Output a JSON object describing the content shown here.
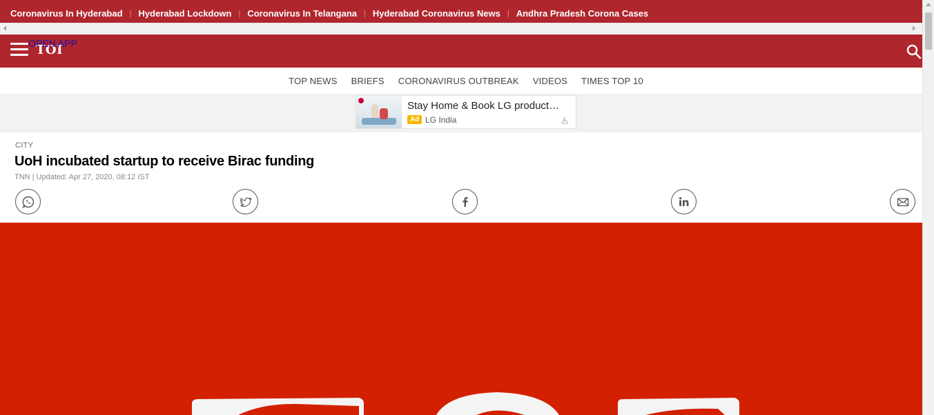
{
  "trending": {
    "links": [
      "Coronavirus In Hyderabad",
      "Hyderabad Lockdown",
      "Coronavirus In Telangana",
      "Hyderabad Coronavirus News",
      "Andhra Pradesh Corona Cases"
    ],
    "separator": "|"
  },
  "header": {
    "logo_text": "TOI",
    "open_app_label": "OPEN APP"
  },
  "subnav": {
    "items": [
      "TOP NEWS",
      "BRIEFS",
      "CORONAVIRUS OUTBREAK",
      "VIDEOS",
      "TIMES TOP 10"
    ]
  },
  "ad": {
    "title": "Stay Home & Book LG product…",
    "badge": "Ad",
    "advertiser": "LG India"
  },
  "article": {
    "section": "CITY",
    "title": "UoH incubated startup to receive Birac funding",
    "byline": "TNN | Updated: Apr 27, 2020, 08:12 IST"
  },
  "share": {
    "icons": [
      "whatsapp-icon",
      "twitter-icon",
      "facebook-icon",
      "linkedin-icon",
      "mail-icon"
    ]
  },
  "colors": {
    "brand_red": "#b0262d",
    "hero_red": "#d32000",
    "link_blue": "#1a0dab",
    "ad_badge": "#f7b500"
  }
}
